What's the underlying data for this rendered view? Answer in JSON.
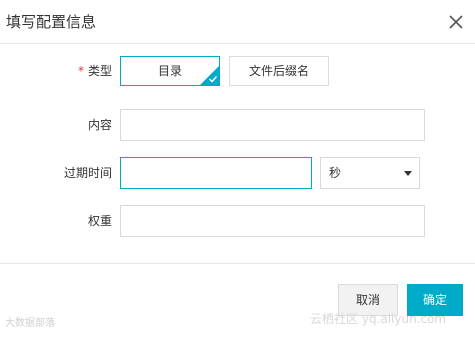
{
  "dialog": {
    "title": "填写配置信息",
    "close_icon": "close-icon"
  },
  "form": {
    "type": {
      "required_mark": "*",
      "label": "类型",
      "options": [
        "目录",
        "文件后缀名"
      ],
      "selected": "目录"
    },
    "content": {
      "label": "内容",
      "value": "",
      "placeholder": ""
    },
    "expire": {
      "label": "过期时间",
      "value": "",
      "placeholder": "",
      "unit": "秒"
    },
    "weight": {
      "label": "权重",
      "value": "",
      "placeholder": ""
    }
  },
  "footer": {
    "cancel_label": "取消",
    "ok_label": "确定"
  },
  "watermarks": {
    "left": "大数据部落",
    "right": "云栖社区 yq.aliyun.com"
  },
  "colors": {
    "accent": "#00aac9",
    "required": "#e4393c"
  }
}
